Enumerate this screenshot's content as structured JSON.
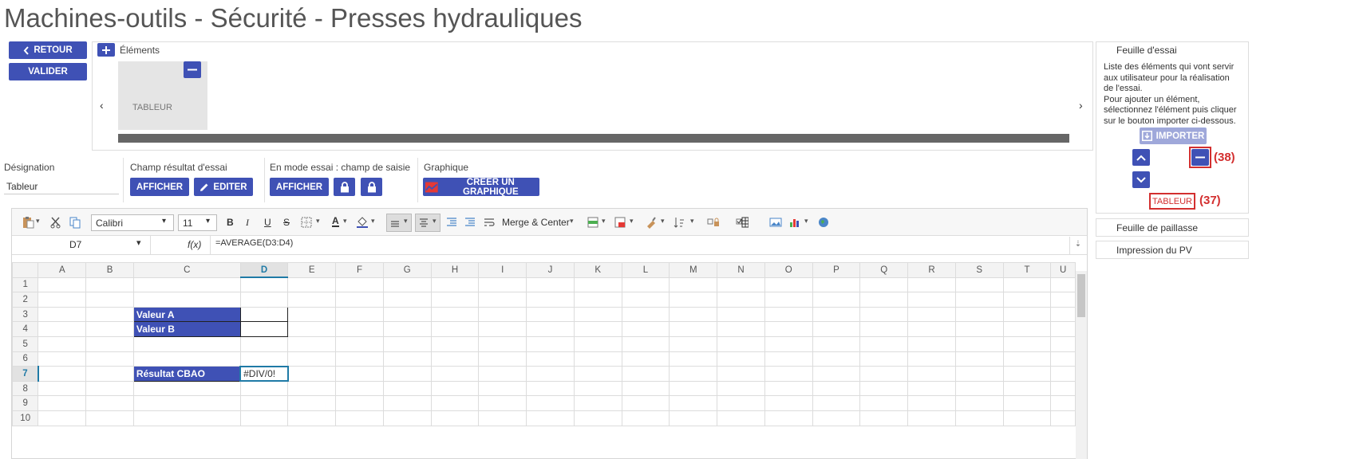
{
  "page": {
    "title": "Machines-outils - Sécurité - Presses hydrauliques"
  },
  "nav": {
    "back_label": "RETOUR",
    "validate_label": "VALIDER"
  },
  "elements": {
    "add_label": "Éléments",
    "cards": [
      {
        "label": "TABLEUR"
      }
    ]
  },
  "fields": {
    "designation": {
      "label": "Désignation",
      "value": "Tableur"
    },
    "result": {
      "label": "Champ résultat d'essai",
      "show_label": "AFFICHER",
      "edit_label": "EDITER"
    },
    "test_mode": {
      "label": "En mode essai : champ de saisie",
      "show_label": "AFFICHER"
    },
    "chart": {
      "label": "Graphique",
      "create_label": "CRÉER UN GRAPHIQUE"
    }
  },
  "right_panel": {
    "sheet_title": "Feuille d'essai",
    "description": [
      "Liste des éléments qui vont servir",
      "aux utilisateur pour la réalisation",
      "de l'essai.",
      "Pour ajouter un élément,",
      "sélectionnez l'élément puis cliquer",
      "sur le bouton importer ci-dessous."
    ],
    "import_label": "IMPORTER",
    "item_label": "TABLEUR",
    "annot_remove": "(38)",
    "annot_item": "(37)",
    "other_sheets": [
      "Feuille de paillasse",
      "Impression du PV"
    ]
  },
  "spreadsheet": {
    "toolbar": {
      "font": "Calibri",
      "size": "11",
      "merge_label": "Merge & Center"
    },
    "name_box": "D7",
    "fx_label": "f(x)",
    "formula": "=AVERAGE(D3:D4)",
    "columns": [
      "A",
      "B",
      "C",
      "D",
      "E",
      "F",
      "G",
      "H",
      "I",
      "J",
      "K",
      "L",
      "M",
      "N",
      "O",
      "P",
      "Q",
      "R",
      "S",
      "T",
      "U"
    ],
    "rows": [
      "1",
      "2",
      "3",
      "4",
      "5",
      "6",
      "7",
      "8",
      "9",
      "10"
    ],
    "selected_column": "D",
    "selected_row": "7",
    "cells": {
      "C3": "Valeur A",
      "C4": "Valeur B",
      "C7": "Résultat CBAO",
      "D7": "#DIV/0!"
    }
  }
}
